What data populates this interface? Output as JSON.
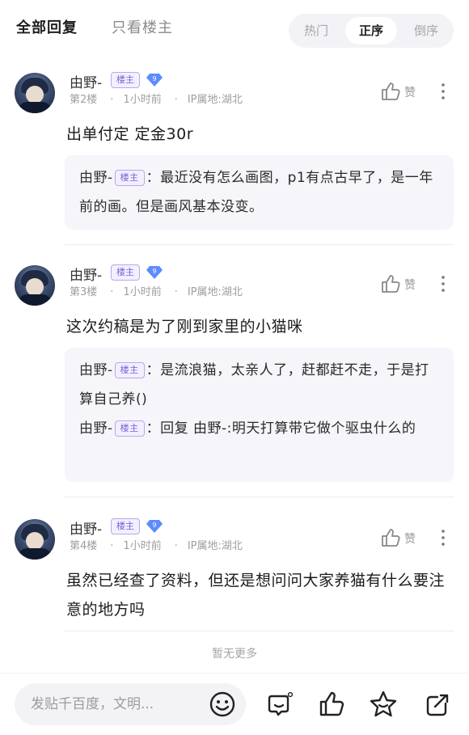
{
  "filters": {
    "all": "全部回复",
    "op_only": "只看楼主"
  },
  "sort": {
    "hot": "热门",
    "asc": "正序",
    "desc": "倒序"
  },
  "posts": [
    {
      "username": "由野-",
      "op_badge": "楼主",
      "level": "9",
      "floor": "第2楼",
      "time": "1小时前",
      "ip": "IP属地:湖北",
      "like_label": "赞",
      "content": "出单付定 定金30r",
      "replies": [
        {
          "name": "由野-",
          "badge": "楼主",
          "text": "：最近没有怎么画图，p1有点古早了，是一年前的画。但是画风基本没变。"
        }
      ]
    },
    {
      "username": "由野-",
      "op_badge": "楼主",
      "level": "9",
      "floor": "第3楼",
      "time": "1小时前",
      "ip": "IP属地:湖北",
      "like_label": "赞",
      "content": "这次约稿是为了刚到家里的小猫咪",
      "replies": [
        {
          "name": "由野-",
          "badge": "楼主",
          "text": "：是流浪猫，太亲人了，赶都赶不走，于是打算自己养()"
        },
        {
          "name": "由野-",
          "badge": "楼主",
          "text": "：回复 由野-:明天打算带它做个驱虫什么的"
        }
      ]
    },
    {
      "username": "由野-",
      "op_badge": "楼主",
      "level": "9",
      "floor": "第4楼",
      "time": "1小时前",
      "ip": "IP属地:湖北",
      "like_label": "赞",
      "content": "虽然已经查了资料，但还是想问问大家养猫有什么要注意的地方吗",
      "replies": []
    }
  ],
  "footer": {
    "no_more": "暂无更多"
  },
  "bottom_bar": {
    "input_placeholder": "发贴千百度，文明...",
    "icons": [
      "emoji-icon",
      "comment-icon",
      "thumb-up-icon",
      "star-icon",
      "share-icon"
    ]
  },
  "colors": {
    "accent": "#7b61d6",
    "level_badge": "#5b8cff",
    "muted": "#9e9e9e",
    "reply_bg": "#f5f5fa"
  }
}
